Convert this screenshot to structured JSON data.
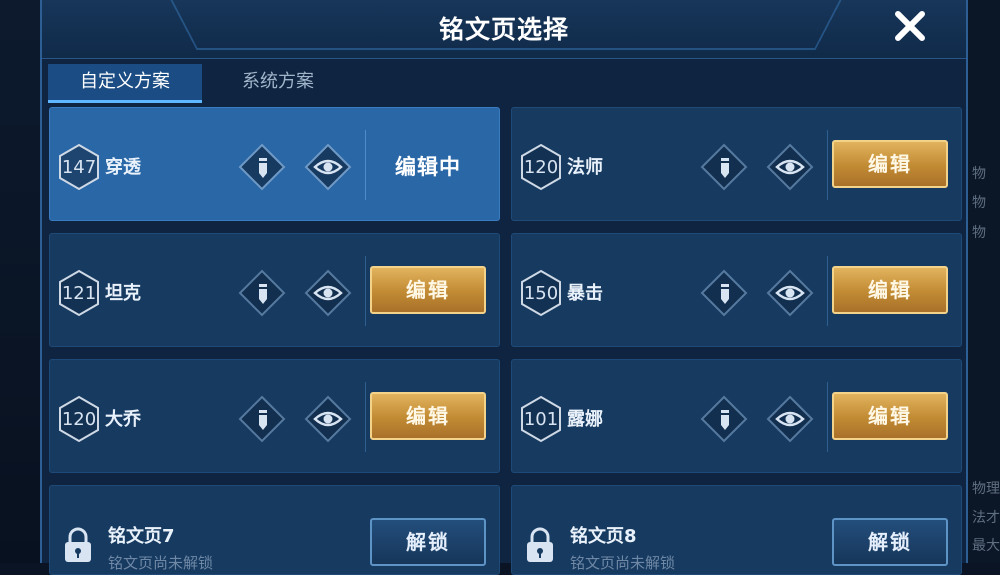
{
  "header": {
    "title": "铭文页选择"
  },
  "tabs": [
    {
      "label": "自定义方案"
    },
    {
      "label": "系统方案"
    }
  ],
  "pages": [
    {
      "level": "147",
      "name": "穿透",
      "action": "编辑中"
    },
    {
      "level": "120",
      "name": "法师",
      "action": "编辑"
    },
    {
      "level": "121",
      "name": "坦克",
      "action": "编辑"
    },
    {
      "level": "150",
      "name": "暴击",
      "action": "编辑"
    },
    {
      "level": "120",
      "name": "大乔",
      "action": "编辑"
    },
    {
      "level": "101",
      "name": "露娜",
      "action": "编辑"
    }
  ],
  "locked_pages": [
    {
      "name": "铭文页7",
      "hint": "铭文页尚未解锁",
      "action": "解锁"
    },
    {
      "name": "铭文页8",
      "hint": "铭文页尚未解锁",
      "action": "解锁"
    }
  ],
  "background_text": [
    "物",
    "物",
    "物",
    "物理",
    "法才",
    "最大"
  ],
  "colors": {
    "accent_gold": "#d3a04b",
    "panel_blue": "#173a60",
    "active_blue": "#2a67a6"
  }
}
